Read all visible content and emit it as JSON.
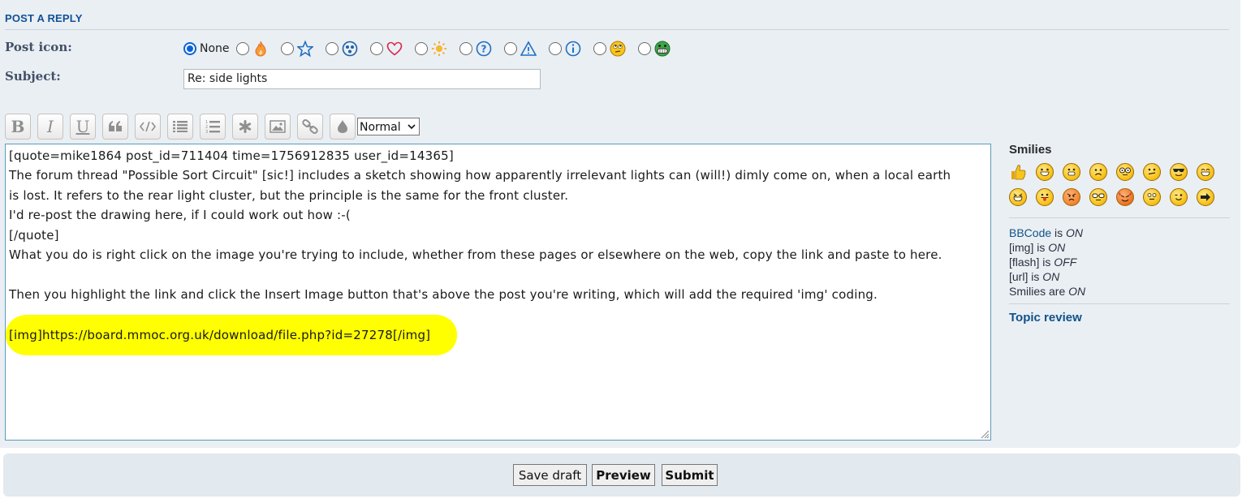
{
  "panel": {
    "title": "POST A REPLY"
  },
  "post_icon": {
    "label": "Post icon:",
    "none_label": "None",
    "selected": "none",
    "options": [
      "flame-icon",
      "star-icon",
      "biohazard-icon",
      "heart-icon",
      "sun-icon",
      "question-icon",
      "warning-icon",
      "info-icon",
      "rolling-eyes-icon",
      "grin-icon"
    ]
  },
  "subject": {
    "label": "Subject:",
    "value": "Re: side lights"
  },
  "toolbar": {
    "buttons": [
      "bold",
      "italic",
      "underline",
      "quote",
      "code",
      "list",
      "numbered-list",
      "list-item",
      "image",
      "link",
      "color"
    ],
    "font_size": "Normal"
  },
  "editor": {
    "lines": [
      "[quote=mike1864 post_id=711404 time=1756912835 user_id=14365]",
      "The forum thread \"Possible Sort Circuit\" [sic!] includes a sketch showing how apparently irrelevant lights can (will!) dimly come on, when a local earth",
      "is lost. It refers to the rear light cluster, but the principle is the same for the front cluster.",
      "I'd re-post the drawing here, if I could work out how  :-(",
      "[/quote]",
      "What you do is right click on the image you're trying to include, whether from these pages or elsewhere on the web, copy the link and paste to here.",
      "",
      "Then you highlight the link and click the Insert Image button that's above the post you're writing, which will add the required 'img' coding.",
      "",
      "[img]https://board.mmoc.org.uk/download/file.php?id=27278[/img]"
    ]
  },
  "sidebar": {
    "smilies_title": "Smilies",
    "smilies": [
      "thumbs-up",
      "grin",
      "happy",
      "sad",
      "geek",
      "confused",
      "cool",
      "laugh",
      "lol",
      "razz",
      "mad",
      "geek-glasses",
      "evil",
      "eek",
      "wink",
      "arrow"
    ],
    "status": [
      {
        "link": "BBCode",
        "text": " is ",
        "value": "ON"
      },
      {
        "link": "",
        "text": "[img] is ",
        "value": "ON"
      },
      {
        "link": "",
        "text": "[flash] is ",
        "value": "OFF"
      },
      {
        "link": "",
        "text": "[url] is ",
        "value": "ON"
      },
      {
        "link": "",
        "text": "Smilies are ",
        "value": "ON"
      }
    ],
    "topic_review": "Topic review"
  },
  "footer": {
    "save_draft": "Save draft",
    "preview": "Preview",
    "submit": "Submit"
  },
  "colors": {
    "accent": "#115098",
    "panel": "#eaeff3",
    "highlight": "#ffff00",
    "link": "#105289"
  }
}
